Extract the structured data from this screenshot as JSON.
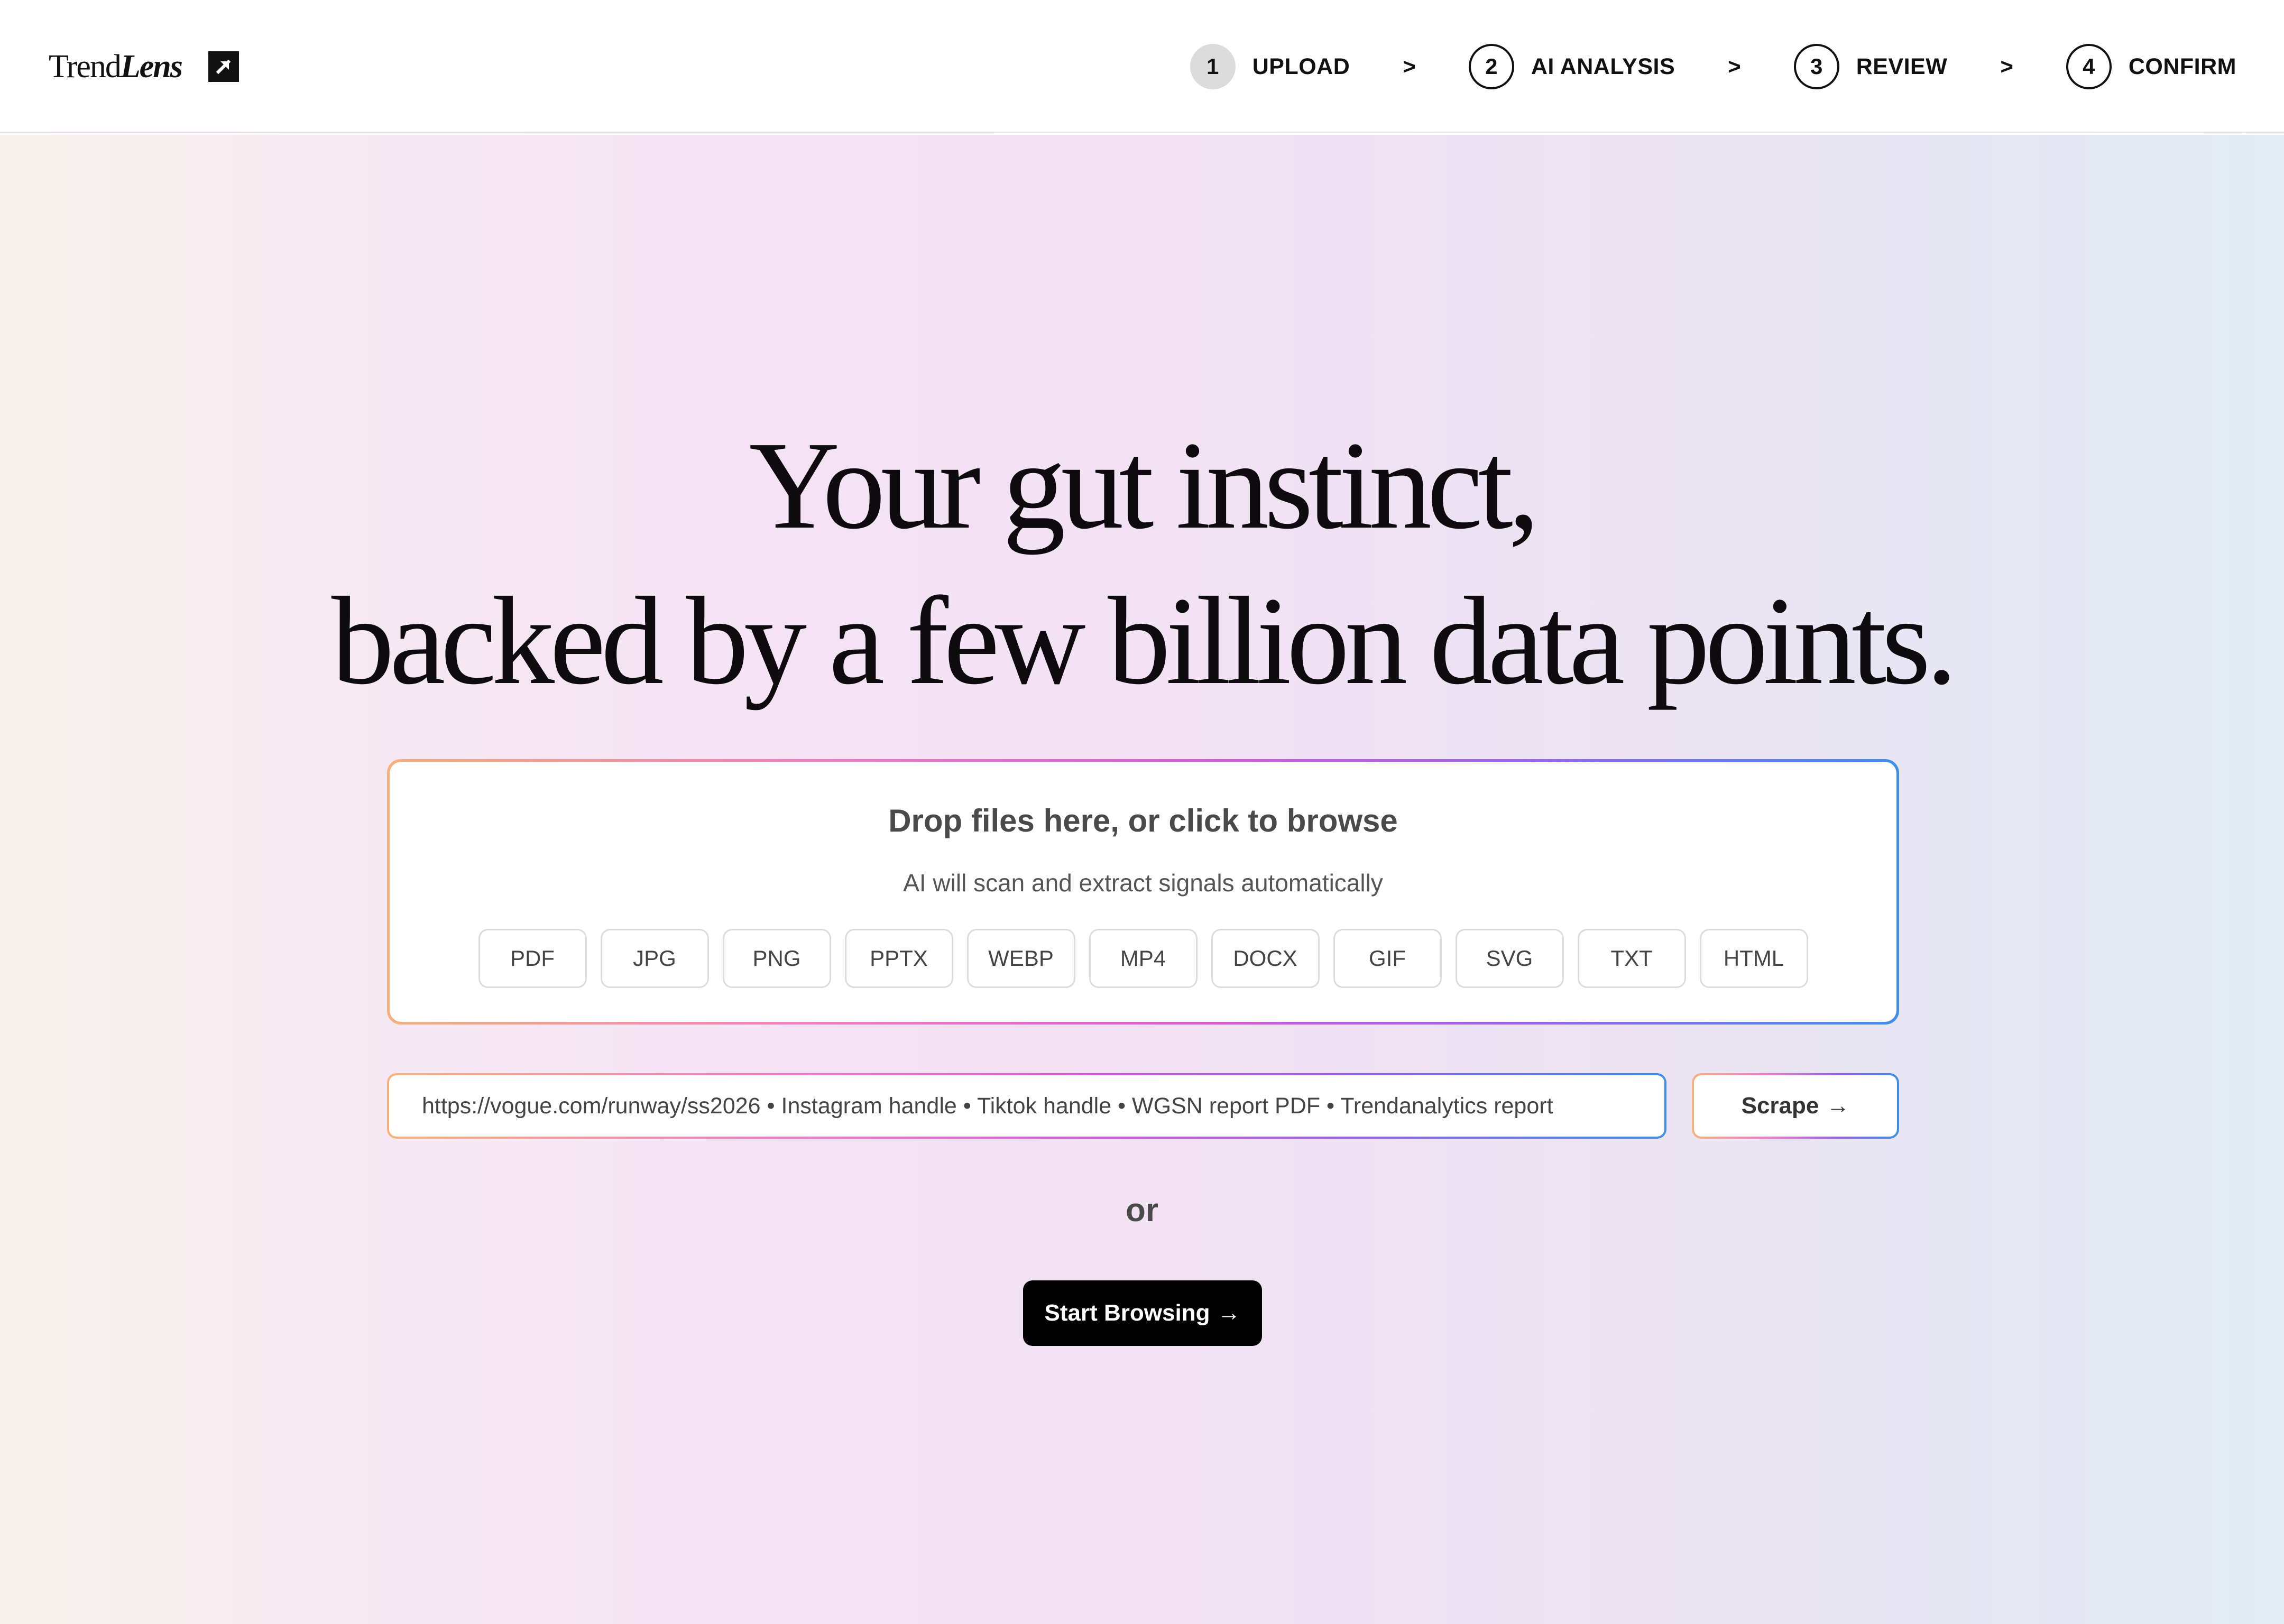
{
  "brand": {
    "name_part1": "Trend",
    "name_part2": "Lens",
    "icon": "arrow-up-right-icon"
  },
  "steps": [
    {
      "number": "1",
      "label": "UPLOAD",
      "active": true
    },
    {
      "number": "2",
      "label": "AI ANALYSIS",
      "active": false
    },
    {
      "number": "3",
      "label": "REVIEW",
      "active": false
    },
    {
      "number": "4",
      "label": "CONFIRM",
      "active": false
    }
  ],
  "step_separator": ">",
  "hero": {
    "headline_line1": "Your gut instinct,",
    "headline_line2": "backed by a few billion data points."
  },
  "dropzone": {
    "title": "Drop files here, or click to browse",
    "subtitle": "AI will scan and extract signals automatically",
    "file_types": [
      "PDF",
      "JPG",
      "PNG",
      "PPTX",
      "WEBP",
      "MP4",
      "DOCX",
      "GIF",
      "SVG",
      "TXT",
      "HTML"
    ]
  },
  "url_input": {
    "placeholder": "https://vogue.com/runway/ss2026 • Instagram handle • Tiktok handle • WGSN report PDF • Trendanalytics report"
  },
  "scrape_button": {
    "label": "Scrape",
    "arrow": "→"
  },
  "divider_text": "or",
  "browse_button": {
    "label": "Start Browsing",
    "arrow": "→"
  },
  "colors": {
    "accent_gradient": [
      "#f7b07a",
      "#ee7cc5",
      "#d35ad9",
      "#9a63e8",
      "#3e8fe8"
    ],
    "primary_button": "#000000",
    "active_step": "#dcdcdc"
  }
}
